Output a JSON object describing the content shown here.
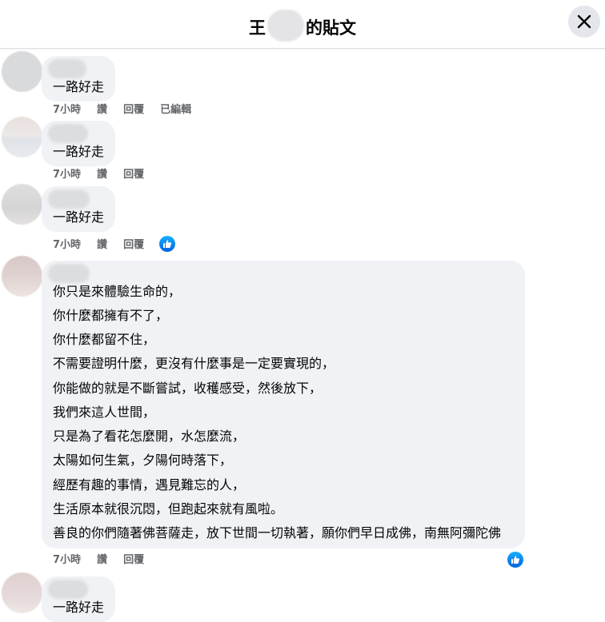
{
  "header": {
    "title_prefix": "王",
    "title_suffix": "的貼文"
  },
  "comments": [
    {
      "text": "一路好走",
      "time": "7小時",
      "like_label": "讚",
      "reply_label": "回覆",
      "edited_label": "已編輯"
    },
    {
      "text": "一路好走",
      "time": "7小時",
      "like_label": "讚",
      "reply_label": "回覆"
    },
    {
      "text": "一路好走",
      "time": "7小時",
      "like_label": "讚",
      "reply_label": "回覆",
      "reaction": "like"
    },
    {
      "lines": [
        "你只是來體驗生命的，",
        "你什麼都擁有不了，",
        "你什麼都留不住，",
        "不需要證明什麼，更沒有什麼事是一定要實現的，",
        "你能做的就是不斷嘗試，收穫感受，然後放下，",
        "我們來這人世間，",
        "只是為了看花怎麼開，水怎麼流，",
        "太陽如何生氣，夕陽何時落下，",
        "經歷有趣的事情，遇見難忘的人，",
        "生活原本就很沉悶，但跑起來就有風啦。",
        "善良的你們隨著佛菩薩走，放下世間一切執著，願你們早日成佛，南無阿彌陀佛"
      ],
      "time": "7小時",
      "like_label": "讚",
      "reply_label": "回覆",
      "reaction": "like"
    },
    {
      "text": "一路好走"
    }
  ],
  "colors": {
    "bubble": "#f0f2f5",
    "meta_text": "#65676b",
    "like_blue": "#0866ff"
  }
}
